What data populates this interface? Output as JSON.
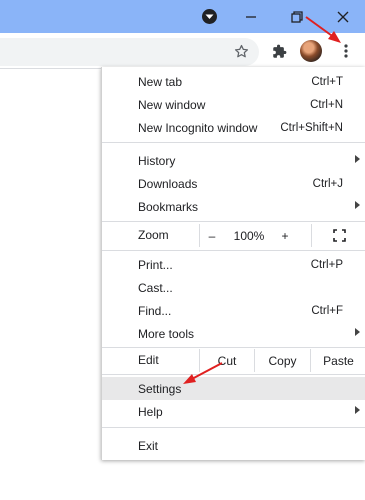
{
  "window": {
    "controls": [
      {
        "icon": "tab-search-icon"
      },
      {
        "icon": "minimize-icon"
      },
      {
        "icon": "restore-icon"
      },
      {
        "icon": "close-icon"
      }
    ]
  },
  "toolbar": {
    "icons": [
      "star-icon",
      "puzzle-extensions-icon",
      "avatar",
      "kebab-menu-icon"
    ]
  },
  "menu": {
    "new_tab": {
      "label": "New tab",
      "shortcut": "Ctrl+T"
    },
    "new_window": {
      "label": "New window",
      "shortcut": "Ctrl+N"
    },
    "new_incognito": {
      "label": "New Incognito window",
      "shortcut": "Ctrl+Shift+N"
    },
    "history": {
      "label": "History"
    },
    "downloads": {
      "label": "Downloads",
      "shortcut": "Ctrl+J"
    },
    "bookmarks": {
      "label": "Bookmarks"
    },
    "zoom": {
      "label": "Zoom",
      "minus": "–",
      "value": "100%",
      "plus": "+"
    },
    "print": {
      "label": "Print...",
      "shortcut": "Ctrl+P"
    },
    "cast": {
      "label": "Cast..."
    },
    "find": {
      "label": "Find...",
      "shortcut": "Ctrl+F"
    },
    "more_tools": {
      "label": "More tools"
    },
    "edit": {
      "label": "Edit",
      "cut": "Cut",
      "copy": "Copy",
      "paste": "Paste"
    },
    "settings": {
      "label": "Settings"
    },
    "help": {
      "label": "Help"
    },
    "exit": {
      "label": "Exit"
    }
  },
  "colors": {
    "titlebar": "#8ab4f8",
    "highlight": "#e8e8e9",
    "annotation_arrow": "#e02020"
  }
}
